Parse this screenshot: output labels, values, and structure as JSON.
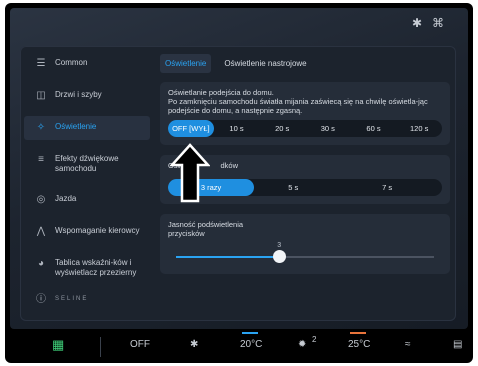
{
  "status": {
    "bluetooth_icon": "bluetooth-icon",
    "wifi_icon": "wifi-icon"
  },
  "sidebar": {
    "items": [
      {
        "label": "Common",
        "icon": "layers-icon"
      },
      {
        "label": "Drzwi i szyby",
        "icon": "car-door-icon"
      },
      {
        "label": "Oświetlenie",
        "icon": "ambient-light-icon"
      },
      {
        "label": "Efekty dźwiękowe samochodu",
        "icon": "equalizer-icon"
      },
      {
        "label": "Jazda",
        "icon": "steering-wheel-icon"
      },
      {
        "label": "Wspomaganie kierowcy",
        "icon": "driver-assist-icon"
      },
      {
        "label": "Tablica wskaźni-ków i wyświetlacz przezierny",
        "icon": "gauge-icon"
      }
    ],
    "about_icon": "info-icon",
    "brand": "SELINE"
  },
  "tabs": [
    {
      "label": "Oświetlenie"
    },
    {
      "label": "Oświetlenie nastrojowe"
    }
  ],
  "approach": {
    "title": "Oświetlanie podejścia do domu.",
    "description": "Po zamknięciu samochodu światła mijania zaświecą się na chwilę oświetla-jąc podejście do domu, a następnie zgasną.",
    "options": [
      "OFF [WYŁ]",
      "10 s",
      "20 s",
      "30 s",
      "60 s",
      "120 s"
    ],
    "selected": "OFF [WYŁ]"
  },
  "second": {
    "title_left": "Ośw",
    "title_right": "dków",
    "options": [
      "3 razy",
      "5 s",
      "7 s"
    ],
    "selected": "3 razy"
  },
  "brightness": {
    "label": "Jasność podświetlenia przycisków",
    "value": "3",
    "level": 0.4
  },
  "taskbar": {
    "apps_icon": "apps-grid-icon",
    "off_label": "OFF",
    "seat_heat_icon": "seat-heat-icon",
    "temp_left": "20°C",
    "fan_icon": "fan-icon",
    "fan_level": "2",
    "temp_right": "25°C",
    "rear_defrost_icon": "defrost-front-icon",
    "rear_window_icon": "defrost-rear-icon"
  },
  "colors": {
    "accent": "#2aa3f2",
    "bg": "#1c232d",
    "orange_indicator": "#e8743b"
  }
}
